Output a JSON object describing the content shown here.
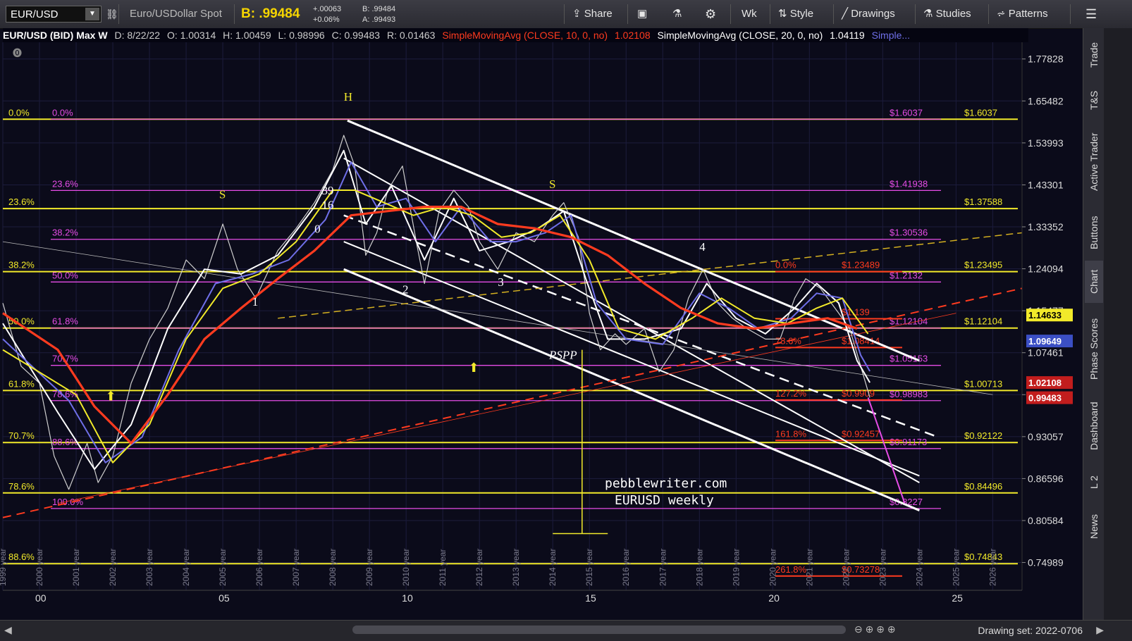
{
  "toolbar": {
    "symbol": "EUR/USD",
    "description": "Euro/USDollar Spot",
    "bid": "B: .99484",
    "change": "+.00063",
    "change_pct": "+0.06%",
    "bid_small": "B: .99484",
    "ask_small": "A: .99493",
    "share": "Share",
    "timeframe": "Wk",
    "style": "Style",
    "drawings": "Drawings",
    "studies": "Studies",
    "patterns": "Patterns"
  },
  "legend": {
    "title": "EUR/USD (BID) Max W",
    "date": "D: 8/22/22",
    "open": "O: 1.00314",
    "high": "H: 1.00459",
    "low": "L: 0.98996",
    "close": "C: 0.99483",
    "range": "R: 0.01463",
    "sma10": "SimpleMovingAvg (CLOSE, 10, 0, no)",
    "sma10_val": "1.02108",
    "sma20": "SimpleMovingAvg (CLOSE, 20, 0, no)",
    "sma20_val": "1.04119",
    "more": "Simple..."
  },
  "right_tabs": [
    "Trade",
    "T&S",
    "Active Trader",
    "Buttons",
    "Chart",
    "Phase Scores",
    "Dashboard",
    "L 2",
    "News"
  ],
  "bottom": {
    "drawing_set": "Drawing set: 2022-0706"
  },
  "colors": {
    "yellow": "#f2ea2a",
    "magenta": "#e64ce6",
    "red": "#ff3b1f",
    "white": "#ffffff",
    "blue": "#6f6fe8",
    "background": "#0b0b1a"
  },
  "chart_data": {
    "type": "line",
    "title": "EUR/USD (BID) Max W",
    "ylim": [
      0.715,
      1.83
    ],
    "ylog": true,
    "xlim": [
      1999.0,
      2026.8
    ],
    "grid": true,
    "y_ticks": [
      "1.77828",
      "1.65482",
      "1.53993",
      "1.43301",
      "1.33352",
      "1.24094",
      "1.15477",
      "1.07461",
      "1.00000",
      "0.93057",
      "0.86596",
      "0.80584",
      "0.74989"
    ],
    "y_tick_values": [
      1.77828,
      1.65482,
      1.53993,
      1.43301,
      1.33352,
      1.24094,
      1.15477,
      1.07461,
      1.0,
      0.93057,
      0.86596,
      0.80584,
      0.74989
    ],
    "x_ticks": [
      "00",
      "05",
      "10",
      "15",
      "20",
      "25"
    ],
    "x_tick_values": [
      2000,
      2005,
      2010,
      2015,
      2020,
      2025
    ],
    "x_year_labels": [
      "1999 year",
      "2000 year",
      "2001 year",
      "2002 year",
      "2003 year",
      "2004 year",
      "2005 year",
      "2006 year",
      "2007 year",
      "2008 year",
      "2009 year",
      "2010 year",
      "2011 year",
      "2012 year",
      "2013 year",
      "2014 year",
      "2015 year",
      "2016 year",
      "2017 year",
      "2018 year",
      "2019 year",
      "2020 year",
      "2021 year",
      "2022 year",
      "2023 year",
      "2024 year",
      "2025 year",
      "2026 year"
    ],
    "series": [
      {
        "name": "EUR/USD",
        "color": "#cfcfcf",
        "x": [
          1999.0,
          1999.5,
          2000.0,
          2000.4,
          2000.8,
          2001.3,
          2001.6,
          2002.0,
          2002.5,
          2003.0,
          2003.5,
          2004.0,
          2004.5,
          2005.0,
          2005.4,
          2005.9,
          2006.5,
          2007.0,
          2007.5,
          2008.0,
          2008.3,
          2008.6,
          2008.9,
          2009.2,
          2009.5,
          2009.9,
          2010.3,
          2010.5,
          2010.9,
          2011.3,
          2011.7,
          2012.0,
          2012.5,
          2013.0,
          2013.5,
          2014.0,
          2014.3,
          2014.7,
          2015.0,
          2015.3,
          2015.7,
          2016.0,
          2016.5,
          2016.9,
          2017.3,
          2017.7,
          2018.1,
          2018.5,
          2018.9,
          2019.3,
          2019.8,
          2020.2,
          2020.6,
          2020.9,
          2021.3,
          2021.8,
          2022.1,
          2022.4,
          2022.65
        ],
        "y": [
          1.17,
          1.05,
          1.02,
          0.9,
          0.85,
          0.92,
          0.86,
          0.9,
          1.02,
          1.1,
          1.16,
          1.26,
          1.22,
          1.34,
          1.24,
          1.18,
          1.28,
          1.33,
          1.39,
          1.47,
          1.56,
          1.48,
          1.27,
          1.32,
          1.42,
          1.48,
          1.29,
          1.21,
          1.37,
          1.42,
          1.38,
          1.3,
          1.24,
          1.32,
          1.3,
          1.36,
          1.39,
          1.31,
          1.15,
          1.08,
          1.11,
          1.09,
          1.12,
          1.04,
          1.08,
          1.18,
          1.24,
          1.17,
          1.14,
          1.12,
          1.1,
          1.1,
          1.18,
          1.22,
          1.2,
          1.15,
          1.12,
          1.05,
          0.995
        ]
      },
      {
        "name": "SMA 10",
        "color": "#ffffff",
        "x": [
          1999.0,
          2000.5,
          2001.5,
          2002.5,
          2003.5,
          2004.5,
          2005.5,
          2006.5,
          2007.5,
          2008.3,
          2008.9,
          2009.6,
          2010.5,
          2011.3,
          2012.0,
          2012.8,
          2013.6,
          2014.3,
          2014.9,
          2015.5,
          2016.5,
          2017.5,
          2018.2,
          2019.0,
          2019.8,
          2020.6,
          2021.2,
          2021.8,
          2022.3,
          2022.65
        ],
        "y": [
          1.13,
          0.97,
          0.88,
          0.95,
          1.12,
          1.24,
          1.23,
          1.27,
          1.38,
          1.52,
          1.34,
          1.43,
          1.26,
          1.4,
          1.28,
          1.3,
          1.33,
          1.37,
          1.22,
          1.1,
          1.1,
          1.12,
          1.21,
          1.14,
          1.11,
          1.16,
          1.21,
          1.17,
          1.06,
          1.021
        ]
      },
      {
        "name": "SMA 20",
        "color": "#6f6fe8",
        "x": [
          1999.0,
          2000.8,
          2001.8,
          2002.8,
          2003.8,
          2004.8,
          2005.8,
          2006.8,
          2007.8,
          2008.5,
          2009.2,
          2010.0,
          2010.8,
          2011.5,
          2012.3,
          2013.0,
          2013.8,
          2014.5,
          2015.2,
          2016.0,
          2017.0,
          2018.0,
          2018.8,
          2019.6,
          2020.5,
          2021.2,
          2021.9,
          2022.4,
          2022.65
        ],
        "y": [
          1.1,
          0.99,
          0.89,
          0.93,
          1.08,
          1.21,
          1.23,
          1.26,
          1.35,
          1.49,
          1.38,
          1.4,
          1.3,
          1.38,
          1.3,
          1.3,
          1.32,
          1.36,
          1.17,
          1.1,
          1.09,
          1.19,
          1.16,
          1.12,
          1.14,
          1.19,
          1.18,
          1.07,
          1.041
        ]
      },
      {
        "name": "SMA 40",
        "color": "#f2ea2a",
        "x": [
          1999.0,
          2001.0,
          2002.0,
          2003.0,
          2004.0,
          2005.0,
          2006.0,
          2007.0,
          2008.0,
          2008.6,
          2009.4,
          2010.2,
          2011.0,
          2011.8,
          2012.6,
          2013.4,
          2014.2,
          2015.0,
          2015.8,
          2016.8,
          2017.8,
          2018.6,
          2019.5,
          2020.4,
          2021.2,
          2021.9,
          2022.6
        ],
        "y": [
          1.08,
          1.0,
          0.89,
          0.95,
          1.1,
          1.2,
          1.23,
          1.3,
          1.42,
          1.42,
          1.39,
          1.36,
          1.38,
          1.36,
          1.31,
          1.32,
          1.36,
          1.26,
          1.12,
          1.1,
          1.14,
          1.18,
          1.14,
          1.13,
          1.16,
          1.18,
          1.11
        ]
      },
      {
        "name": "SMA 100",
        "color": "#ff3b1f",
        "x": [
          1999.0,
          2000.5,
          2001.5,
          2002.5,
          2003.5,
          2004.5,
          2005.5,
          2006.5,
          2007.5,
          2008.5,
          2009.5,
          2010.5,
          2011.5,
          2012.5,
          2013.5,
          2014.5,
          2015.5,
          2016.5,
          2017.5,
          2018.5,
          2019.5,
          2020.5,
          2021.5,
          2022.3
        ],
        "y": [
          1.15,
          1.08,
          0.98,
          0.92,
          1.0,
          1.1,
          1.16,
          1.22,
          1.28,
          1.36,
          1.37,
          1.38,
          1.38,
          1.34,
          1.33,
          1.31,
          1.27,
          1.21,
          1.16,
          1.13,
          1.12,
          1.13,
          1.14,
          1.12
        ]
      }
    ],
    "fib_left": [
      {
        "label": "0.0%",
        "y": 1.6037
      },
      {
        "label": "23.6%",
        "y": 1.3758
      },
      {
        "label": "38.2%",
        "y": 1.2349
      },
      {
        "label": "50.0%",
        "y": 1.121
      },
      {
        "label": "61.8%",
        "y": 1.0071
      },
      {
        "label": "70.7%",
        "y": 0.9212
      },
      {
        "label": "78.6%",
        "y": 0.8449
      },
      {
        "label": "88.6%",
        "y": 0.7484
      }
    ],
    "fib_left_values": [
      "$1.6037",
      "$1.37588",
      "$1.23495",
      "$1.12104",
      "$1.00713",
      "$0.92122",
      "$0.84496",
      "$0.74843"
    ],
    "fib_inner": [
      {
        "label": "0.0%",
        "y": 1.6037,
        "value": "$1.6037"
      },
      {
        "label": "23.6%",
        "y": 1.4193,
        "value": "$1.41938"
      },
      {
        "label": "38.2%",
        "y": 1.3053,
        "value": "$1.30536"
      },
      {
        "label": "50.0%",
        "y": 1.2132,
        "value": "$1.2132"
      },
      {
        "label": "61.8%",
        "y": 1.121,
        "value": "$1.12104"
      },
      {
        "label": "70.7%",
        "y": 1.0515,
        "value": "$1.05153"
      },
      {
        "label": "78.6%",
        "y": 0.9898,
        "value": "$0.98983"
      },
      {
        "label": "88.6%",
        "y": 0.9117,
        "value": "$0.91173"
      },
      {
        "label": "100.0%",
        "y": 0.8227,
        "value": "$0.8227"
      }
    ],
    "fib_red": [
      {
        "label": "0.0%",
        "y": 1.2348,
        "value": "$1.23489"
      },
      {
        "label": "",
        "y": 1.139,
        "value": "$1.139"
      },
      {
        "label": "78.6%",
        "y": 1.0841,
        "value": "$1.08414"
      },
      {
        "label": "127.2%",
        "y": 0.9909,
        "value": "$0.9909"
      },
      {
        "label": "161.8%",
        "y": 0.9245,
        "value": "$0.92457"
      },
      {
        "label": "261.8%",
        "y": 0.7327,
        "value": "$0.73278"
      }
    ],
    "annotations": [
      {
        "text": "H",
        "x": 2008.3,
        "y": 1.655
      },
      {
        "text": "S",
        "x": 2004.9,
        "y": 1.4
      },
      {
        "text": "S",
        "x": 2013.9,
        "y": 1.425
      },
      {
        "text": "1",
        "x": 2005.8,
        "y": 1.165
      },
      {
        "text": "2",
        "x": 2009.9,
        "y": 1.19
      },
      {
        "text": "3",
        "x": 2012.5,
        "y": 1.205
      },
      {
        "text": "4",
        "x": 2018.0,
        "y": 1.28
      },
      {
        "text": "39",
        "x": 2007.7,
        "y": 1.41
      },
      {
        "text": "16",
        "x": 2007.7,
        "y": 1.375
      },
      {
        "text": "0",
        "x": 2007.5,
        "y": 1.32
      },
      {
        "text": "PSPP",
        "x": 2013.9,
        "y": 1.063
      }
    ],
    "watermark": [
      "pebblewriter.com",
      "EURUSD weekly"
    ],
    "price_labels": [
      {
        "text": "1.14633",
        "y": 1.1463,
        "bg": "#f2ea2a",
        "fg": "#000"
      },
      {
        "text": "1.09649",
        "y": 1.0964,
        "bg": "#3b4fc4",
        "fg": "#fff"
      },
      {
        "text": "1.02108",
        "y": 1.021,
        "bg": "#c21d1d",
        "fg": "#fff"
      },
      {
        "text": "0.99483",
        "y": 0.9948,
        "bg": "#c21d1d",
        "fg": "#fff"
      }
    ]
  }
}
